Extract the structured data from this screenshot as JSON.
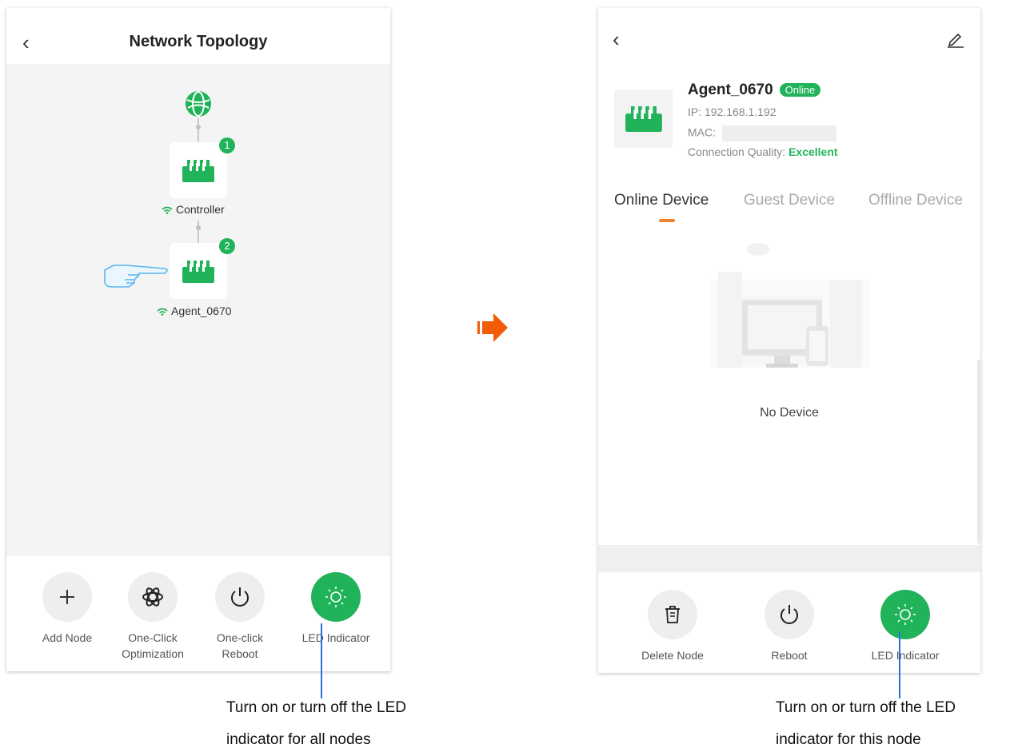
{
  "left": {
    "title": "Network Topology",
    "nodes": [
      {
        "badge": "1",
        "label": "Controller"
      },
      {
        "badge": "2",
        "label": "Agent_0670"
      }
    ],
    "actions": [
      {
        "label": "Add Node",
        "icon": "plus-icon"
      },
      {
        "label": "One-Click\nOptimization",
        "icon": "atom-icon"
      },
      {
        "label": "One-click\nReboot",
        "icon": "power-icon"
      },
      {
        "label": "LED Indicator",
        "icon": "led-icon"
      }
    ],
    "annotation": "Turn on or turn off the LED\nindicator for all nodes"
  },
  "right": {
    "device_name": "Agent_0670",
    "status": "Online",
    "ip_label": "IP: 192.168.1.192",
    "mac_label": "MAC:",
    "quality_label": "Connection Quality:",
    "quality_value": "Excellent",
    "tabs": [
      "Online Device",
      "Guest Device",
      "Offline Device"
    ],
    "empty_text": "No Device",
    "actions": [
      {
        "label": "Delete Node",
        "icon": "trash-icon"
      },
      {
        "label": "Reboot",
        "icon": "power-icon"
      },
      {
        "label": "LED Indicator",
        "icon": "led-icon"
      }
    ],
    "annotation": "Turn on or turn off the LED\nindicator for this node"
  },
  "colors": {
    "accent_green": "#21b35a",
    "arrow_orange": "#f25c05",
    "tab_indicator": "#f0822c",
    "annotation_line": "#2a6fdb"
  }
}
